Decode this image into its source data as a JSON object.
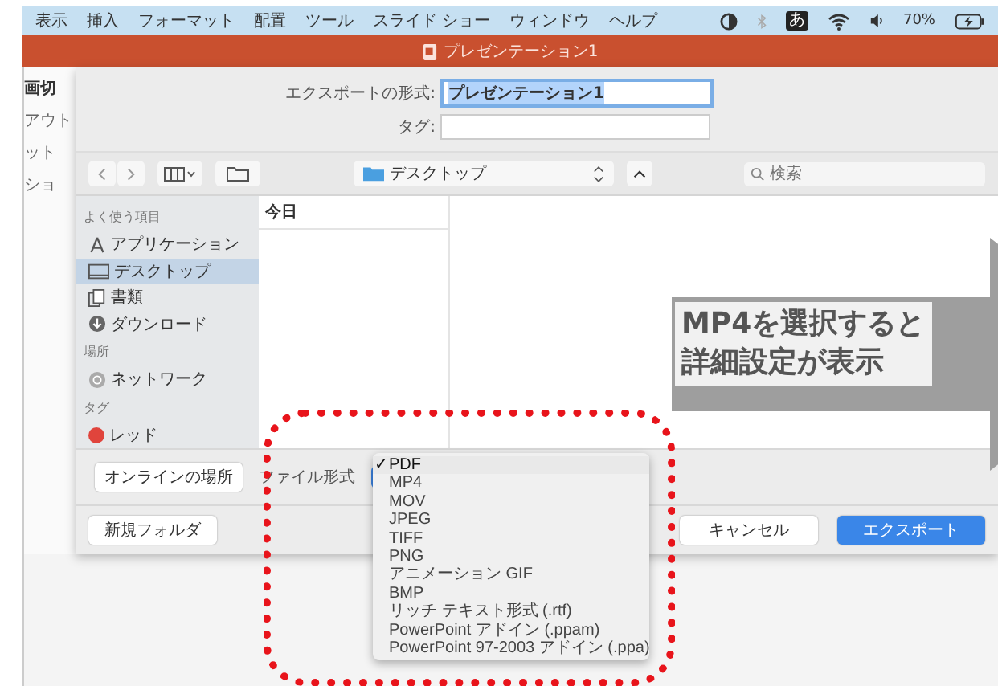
{
  "menubar": {
    "items": [
      "表示",
      "挿入",
      "フォーマット",
      "配置",
      "ツール",
      "スライド ショー",
      "ウィンドウ",
      "ヘルプ"
    ],
    "input_badge": "あ",
    "battery": "70%"
  },
  "titlebar": {
    "title": "プレゼンテーション1"
  },
  "app_sidebar": [
    "画切",
    "アウト",
    "ット",
    "ショ"
  ],
  "dialog": {
    "export_label": "エクスポートの形式:",
    "export_value": "プレゼンテーション1",
    "tag_label": "タグ:",
    "location": "デスクトップ",
    "search": {
      "placeholder": "検索"
    },
    "sidebar": [
      {
        "kind": "header",
        "label": "よく使う項目"
      },
      {
        "kind": "apps",
        "label": "アプリケーション",
        "selected": false
      },
      {
        "kind": "desktop",
        "label": "デスクトップ",
        "selected": true
      },
      {
        "kind": "docs",
        "label": "書類",
        "selected": false
      },
      {
        "kind": "download",
        "label": "ダウンロード",
        "selected": false
      },
      {
        "kind": "header",
        "label": "場所"
      },
      {
        "kind": "network",
        "label": "ネットワーク",
        "selected": false
      },
      {
        "kind": "header",
        "label": "タグ"
      },
      {
        "kind": "tag",
        "label": "レッド",
        "selected": false,
        "color": "#e0443c"
      }
    ],
    "column_header": "今日",
    "online_button": "オンラインの場所",
    "format_label": "ファイル形式",
    "new_folder": "新規フォルダ",
    "cancel": "キャンセル",
    "export": "エクスポート"
  },
  "format_menu": {
    "check": "✓",
    "items": [
      {
        "label": "PDF",
        "selected": true
      },
      {
        "label": "MP4",
        "selected": false
      },
      {
        "label": "MOV",
        "selected": false
      },
      {
        "label": "JPEG",
        "selected": false
      },
      {
        "label": "TIFF",
        "selected": false
      },
      {
        "label": "PNG",
        "selected": false
      },
      {
        "label": "アニメーション GIF",
        "selected": false
      },
      {
        "label": "BMP",
        "selected": false
      },
      {
        "label": "リッチ テキスト形式 (.rtf)",
        "selected": false
      },
      {
        "label": "PowerPoint アドイン (.ppam)",
        "selected": false
      },
      {
        "label": "PowerPoint 97-2003 アドイン (.ppa)",
        "selected": false
      }
    ]
  },
  "callout": {
    "lines": [
      "MP4を選択すると",
      "詳細設定が表示"
    ]
  }
}
